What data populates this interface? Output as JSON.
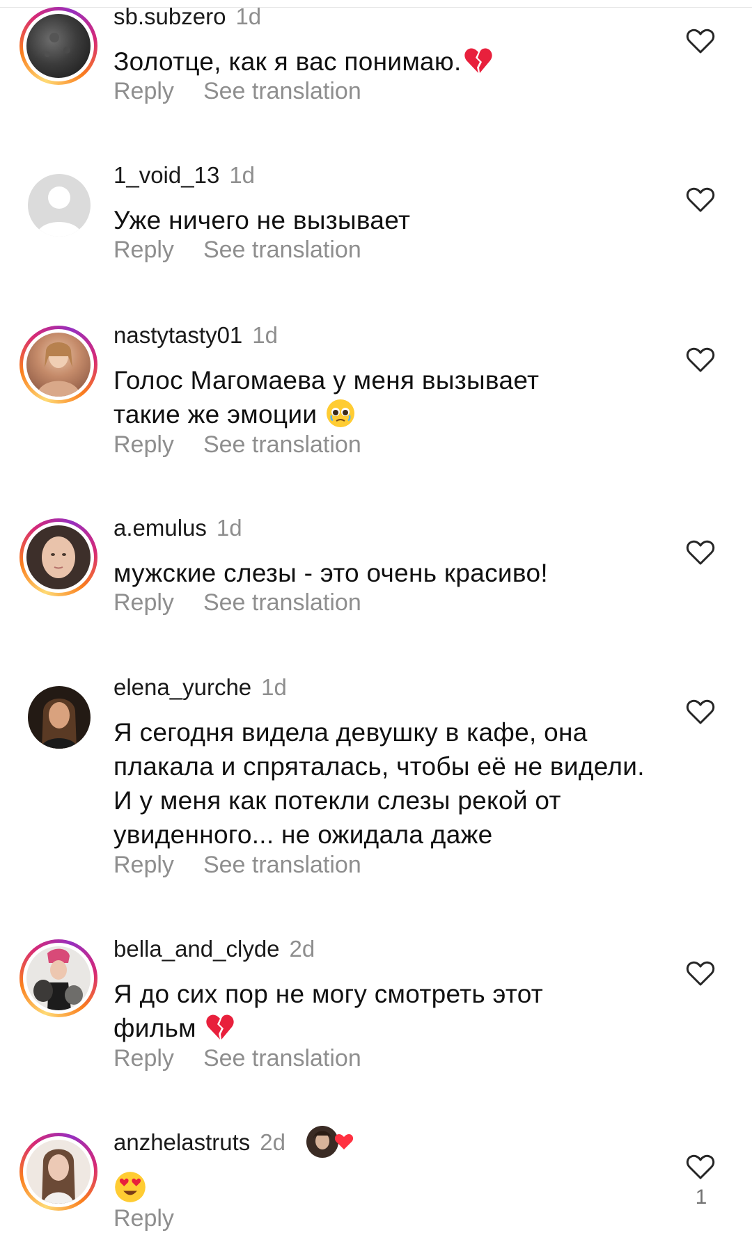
{
  "comments": [
    {
      "username": "sb.subzero",
      "time": "1d",
      "text": "Золотце, как я вас понимаю.",
      "emoji": "broken-heart",
      "reply": "Reply",
      "translate": "See translation"
    },
    {
      "username": "1_void_13",
      "time": "1d",
      "text": "Уже ничего не вызывает",
      "reply": "Reply",
      "translate": "See translation"
    },
    {
      "username": "nastytasty01",
      "time": "1d",
      "text": "Голос Магомаева у меня вызывает такие же эмоции",
      "emoji": "pleading-face",
      "reply": "Reply",
      "translate": "See translation"
    },
    {
      "username": "a.emulus",
      "time": "1d",
      "text": "мужские слезы - это очень красиво!",
      "reply": "Reply",
      "translate": "See translation"
    },
    {
      "username": "elena_yurche",
      "time": "1d",
      "text": "Я сегодня видела девушку в кафе, она плакала и спряталась, чтобы её не видели. И у меня как потекли слезы рекой от увиденного... не ожидала даже",
      "reply": "Reply",
      "translate": "See translation"
    },
    {
      "username": "bella_and_clyde",
      "time": "2d",
      "text": "Я до сих пор не могу смотреть этот фильм",
      "emoji": "broken-heart",
      "reply": "Reply",
      "translate": "See translation"
    },
    {
      "username": "anzhelastruts",
      "time": "2d",
      "emoji": "heart-eyes-face",
      "reply": "Reply",
      "like_count": "1",
      "liked_by_author": true
    }
  ],
  "icons": {
    "like": "heart-outline-icon",
    "author_like": "red-heart-icon"
  },
  "colors": {
    "background": "#ffffff",
    "secondary_text": "#8e8e8e",
    "story_ring": [
      "#feda75",
      "#fa7e1e",
      "#d62976",
      "#962fbf"
    ],
    "heart_red": "#ff3040"
  }
}
